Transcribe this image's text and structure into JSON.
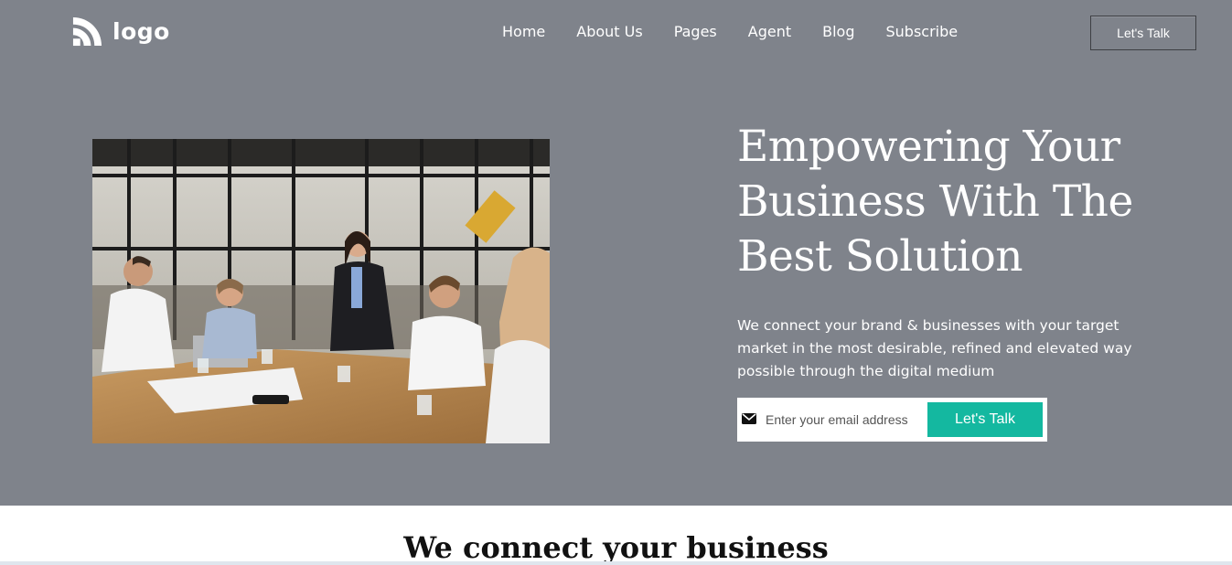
{
  "header": {
    "logo_text": "logo",
    "nav": [
      "Home",
      "About Us",
      "Pages",
      "Agent",
      "Blog",
      "Subscribe"
    ],
    "cta_label": "Let's Talk"
  },
  "hero": {
    "headline": "Empowering Your Business With The Best Solution",
    "subtext": "We connect your brand & businesses with your target market in the most desirable, refined and elevated way possible through the digital medium",
    "email_placeholder": "Enter your email address",
    "submit_label": "Let's Talk",
    "photo_icon": "office-meeting-photo"
  },
  "section": {
    "title": "We connect your business"
  },
  "colors": {
    "hero_bg": "#7f838b",
    "accent": "#14b8a0",
    "text_light": "#ffffff"
  }
}
